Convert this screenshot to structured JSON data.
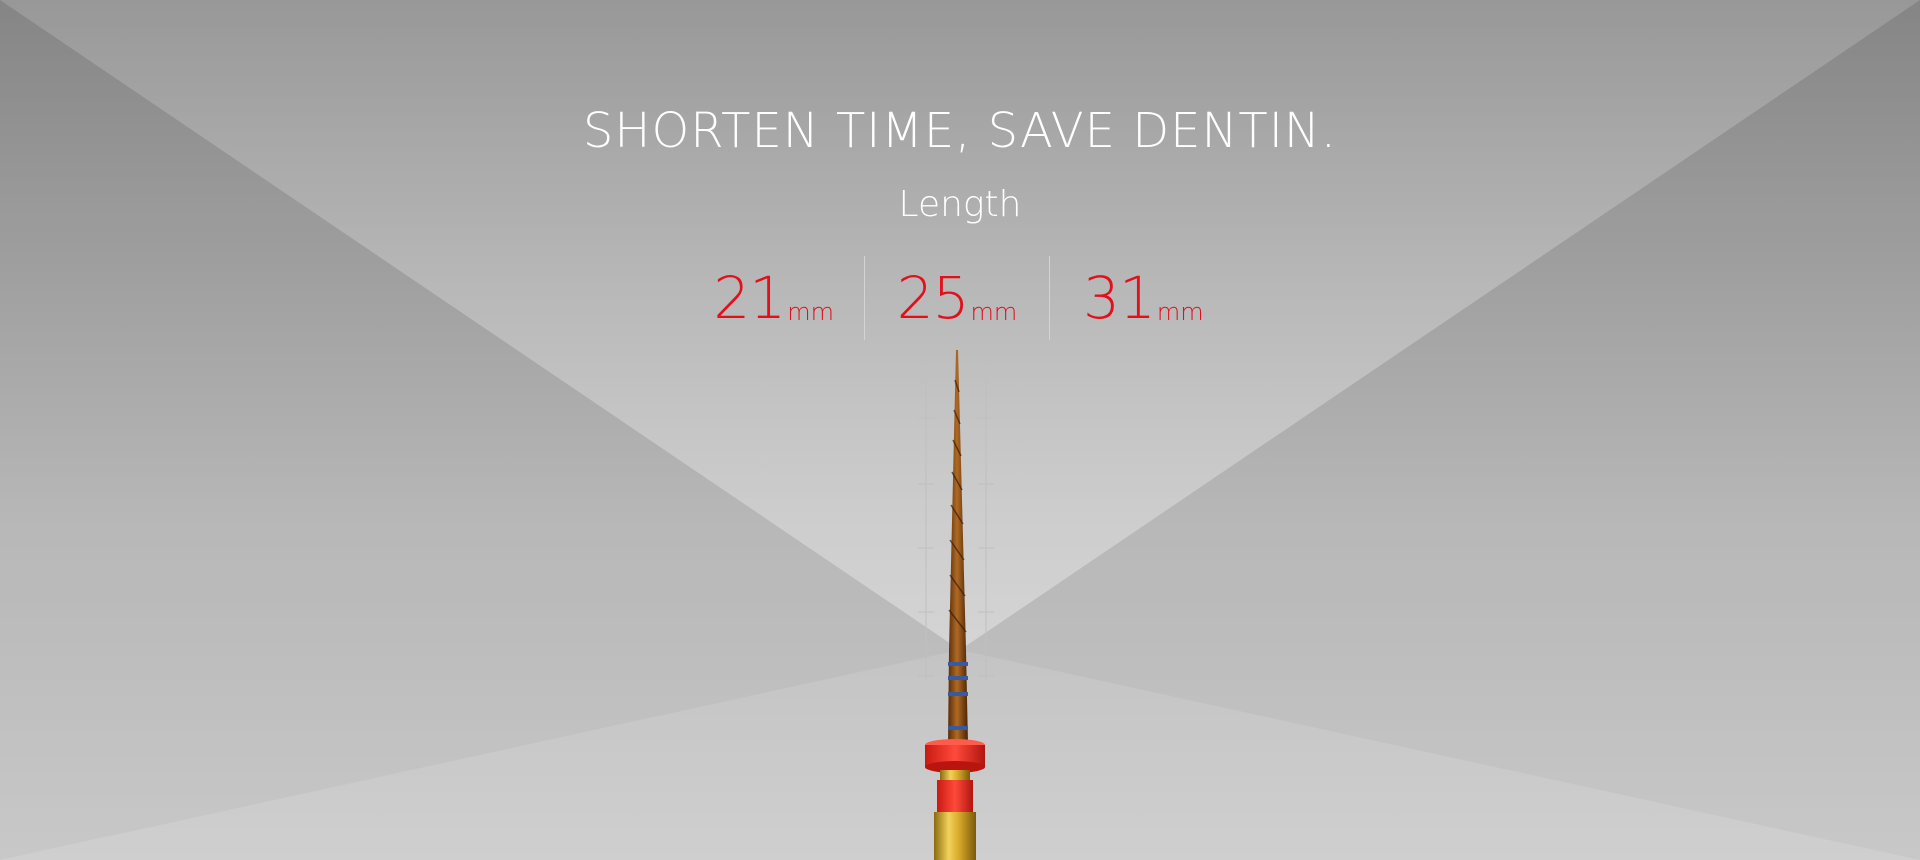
{
  "hero": {
    "headline": "SHORTEN TIME, SAVE DENTIN.",
    "subtitle": "Length"
  },
  "lengths": [
    {
      "value": "21",
      "unit": "mm"
    },
    {
      "value": "25",
      "unit": "mm"
    },
    {
      "value": "31",
      "unit": "mm"
    }
  ],
  "colors": {
    "accent": "#e2101b",
    "text": "#ffffff",
    "file_shaft": "#8a4a14",
    "file_ring": "#ff3a2e",
    "handle_gold": "#c9a024"
  },
  "product": {
    "name": "endodontic-file-icon"
  }
}
